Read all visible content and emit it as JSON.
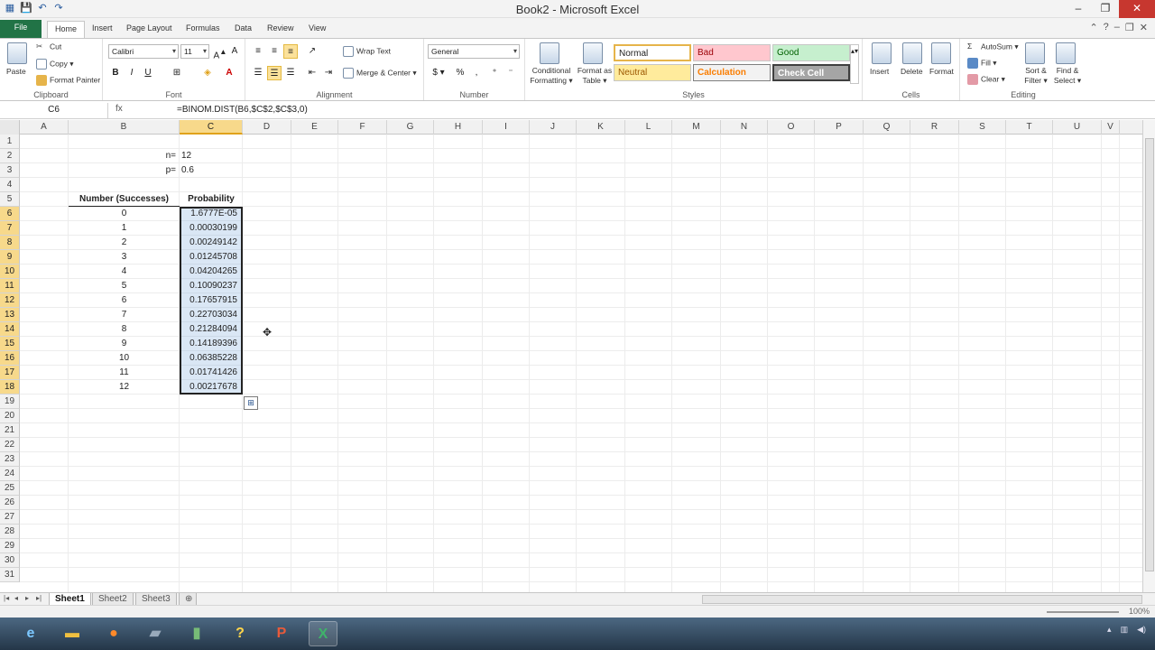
{
  "window": {
    "title": "Book2 - Microsoft Excel"
  },
  "ribbon_tabs": [
    "File",
    "Home",
    "Insert",
    "Page Layout",
    "Formulas",
    "Data",
    "Review",
    "View"
  ],
  "clipboard": {
    "paste": "Paste",
    "cut": "Cut",
    "copy": "Copy ▾",
    "format_painter": "Format Painter",
    "label": "Clipboard"
  },
  "font": {
    "name": "Calibri",
    "size": "11",
    "bold": "B",
    "italic": "I",
    "underline": "U",
    "label": "Font"
  },
  "alignment": {
    "wrap": "Wrap Text",
    "merge": "Merge & Center ▾",
    "label": "Alignment"
  },
  "number": {
    "format": "General",
    "currency": "$ ▾",
    "percent": "%",
    "comma": ",",
    "label": "Number"
  },
  "styles": {
    "conditional": "Conditional Formatting ▾",
    "format_table": "Format as Table ▾",
    "normal": "Normal",
    "bad": "Bad",
    "good": "Good",
    "neutral": "Neutral",
    "calculation": "Calculation",
    "check_cell": "Check Cell",
    "label": "Styles"
  },
  "cells_group": {
    "insert": "Insert",
    "delete": "Delete",
    "format": "Format",
    "label": "Cells"
  },
  "editing": {
    "autosum": "AutoSum ▾",
    "fill": "Fill ▾",
    "clear": "Clear ▾",
    "sort": "Sort & Filter ▾",
    "find": "Find & Select ▾",
    "label": "Editing"
  },
  "formula_bar": {
    "name_box": "C6",
    "fx": "fx",
    "formula": "=BINOM.DIST(B6,$C$2,$C$3,0)"
  },
  "columns": [
    "A",
    "B",
    "C",
    "D",
    "E",
    "F",
    "G",
    "H",
    "I",
    "J",
    "K",
    "L",
    "M",
    "N",
    "O",
    "P",
    "Q",
    "R",
    "S",
    "T",
    "U",
    "V"
  ],
  "rows": [
    "1",
    "2",
    "3",
    "4",
    "5",
    "6",
    "7",
    "8",
    "9",
    "10",
    "11",
    "12",
    "13",
    "14",
    "15",
    "16",
    "17",
    "18",
    "19",
    "20",
    "21",
    "22",
    "23",
    "24",
    "25",
    "26",
    "27",
    "28",
    "29",
    "30",
    "31"
  ],
  "sheet": {
    "n_label": "n=",
    "n_value": "12",
    "p_label": "p=",
    "p_value": "0.6",
    "header_b": "Number (Successes)",
    "header_c": "Probability",
    "successes": [
      "0",
      "1",
      "2",
      "3",
      "4",
      "5",
      "6",
      "7",
      "8",
      "9",
      "10",
      "11",
      "12"
    ],
    "probabilities": [
      "1.6777E-05",
      "0.00030199",
      "0.00249142",
      "0.01245708",
      "0.04204265",
      "0.10090237",
      "0.17657915",
      "0.22703034",
      "0.21284094",
      "0.14189396",
      "0.06385228",
      "0.01741426",
      "0.00217678"
    ]
  },
  "sheet_tabs": [
    "Sheet1",
    "Sheet2",
    "Sheet3"
  ],
  "status": {
    "ready": "",
    "zoom": "100%"
  }
}
